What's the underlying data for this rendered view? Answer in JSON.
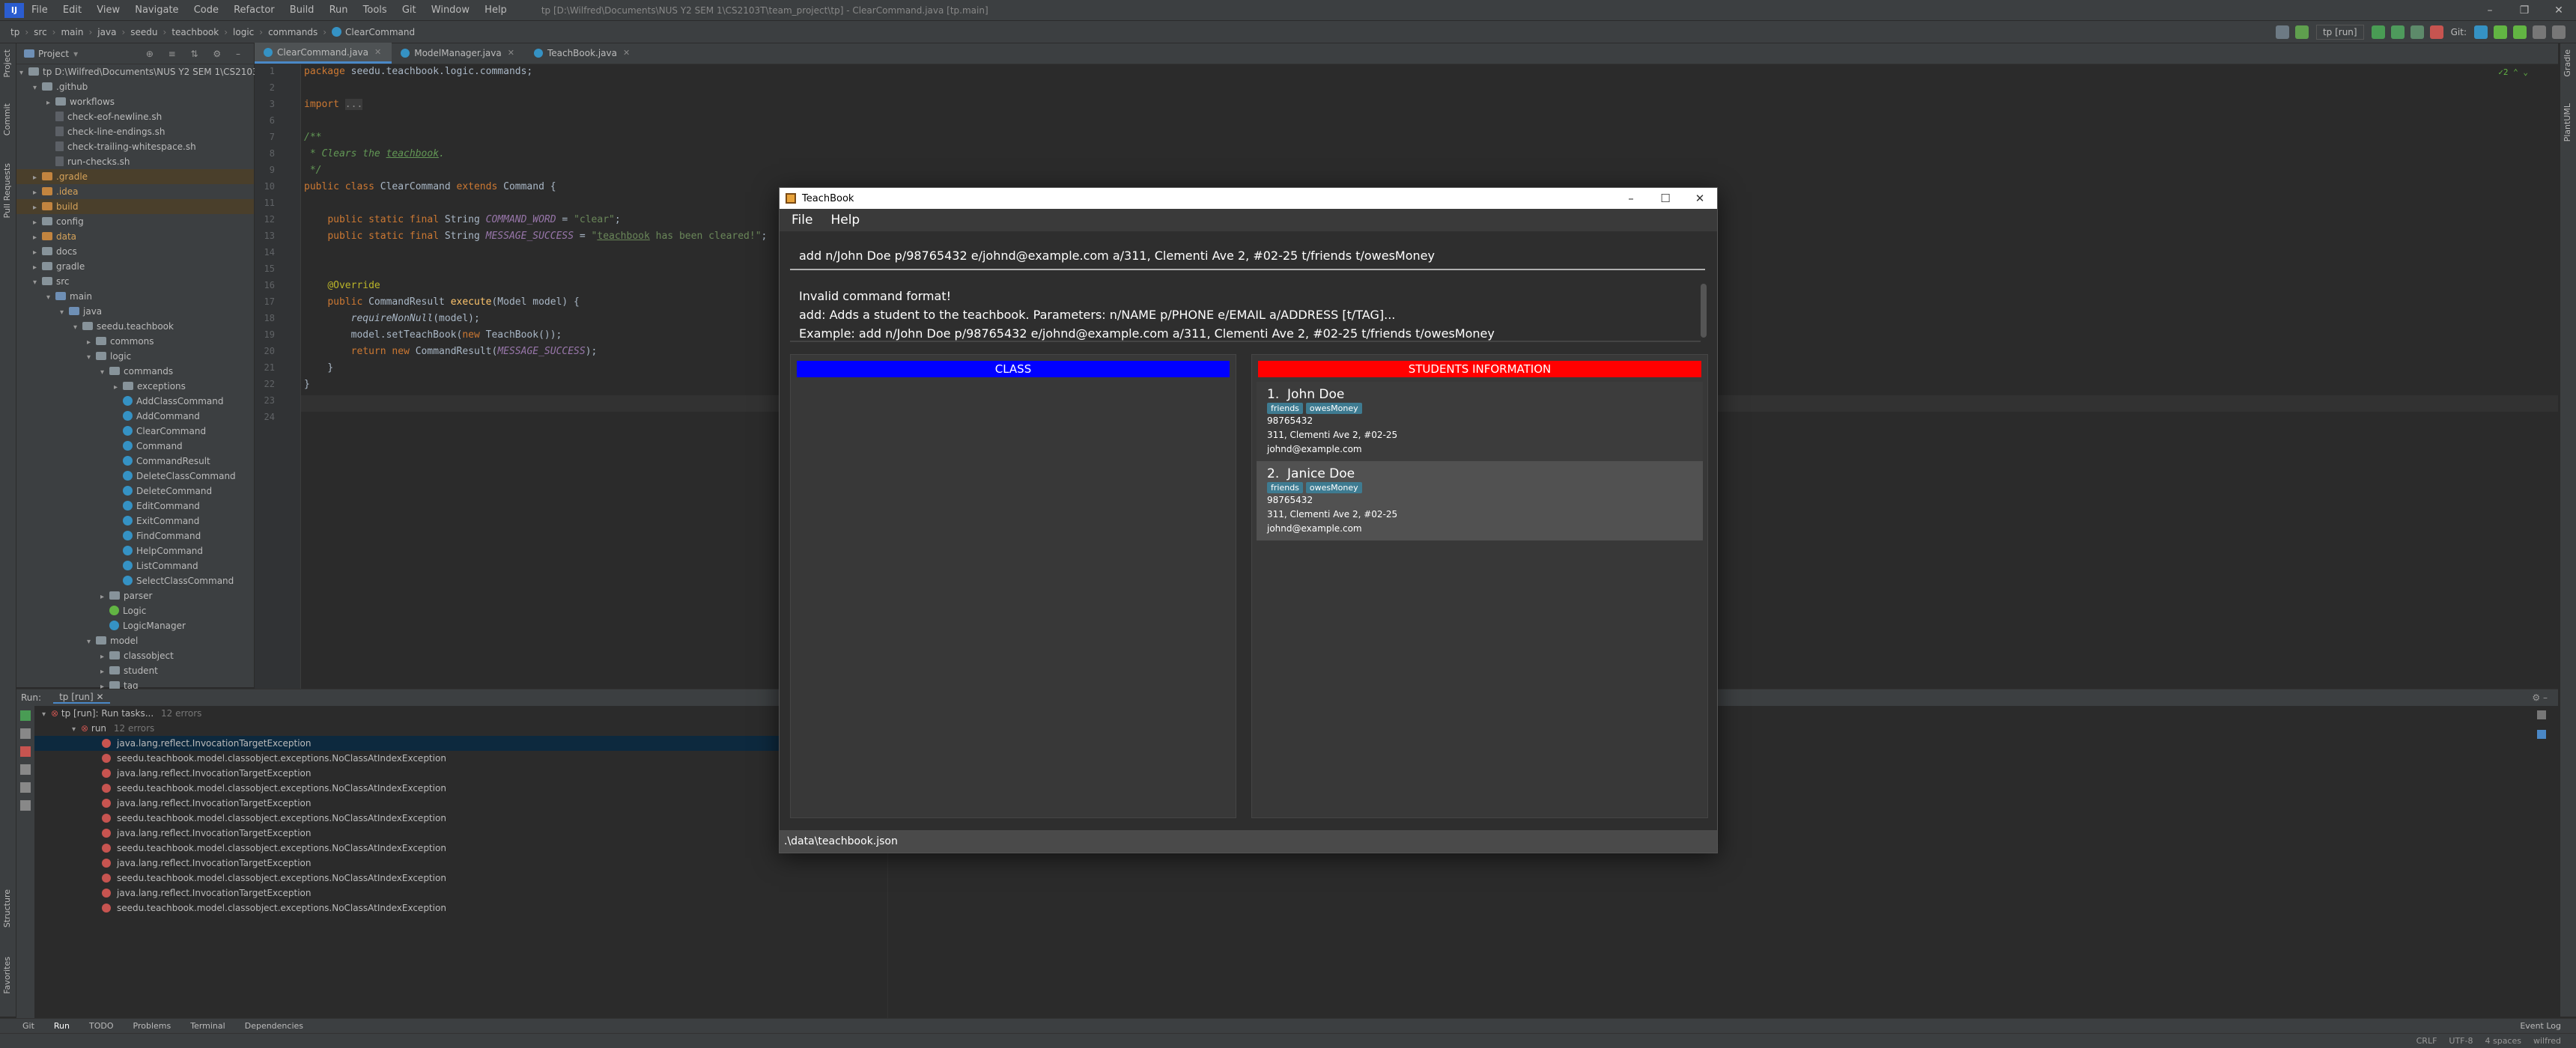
{
  "titlebar": {
    "menu": [
      "File",
      "Edit",
      "View",
      "Navigate",
      "Code",
      "Refactor",
      "Build",
      "Run",
      "Tools",
      "Git",
      "Window",
      "Help"
    ],
    "path": "tp [D:\\Wilfred\\Documents\\NUS Y2 SEM 1\\CS2103T\\team_project\\tp] - ClearCommand.java [tp.main]",
    "run_config": "tp [run]",
    "git_label": "Git:"
  },
  "breadcrumb": [
    "tp",
    "src",
    "main",
    "java",
    "seedu",
    "teachbook",
    "logic",
    "commands",
    "ClearCommand"
  ],
  "project": {
    "header": "Project",
    "rows": [
      {
        "label": "tp D:\\Wilfred\\Documents\\NUS Y2 SEM 1\\CS2103T\\team_project\\tp",
        "depth": 0,
        "kind": "folder",
        "open": true
      },
      {
        "label": ".github",
        "depth": 1,
        "kind": "folder",
        "open": true
      },
      {
        "label": "workflows",
        "depth": 2,
        "kind": "folder",
        "open": false
      },
      {
        "label": "check-eof-newline.sh",
        "depth": 2,
        "kind": "file"
      },
      {
        "label": "check-line-endings.sh",
        "depth": 2,
        "kind": "file"
      },
      {
        "label": "check-trailing-whitespace.sh",
        "depth": 2,
        "kind": "file"
      },
      {
        "label": "run-checks.sh",
        "depth": 2,
        "kind": "file"
      },
      {
        "label": ".gradle",
        "depth": 1,
        "kind": "folder-orange",
        "open": false,
        "hl": true
      },
      {
        "label": ".idea",
        "depth": 1,
        "kind": "folder-orange",
        "open": false
      },
      {
        "label": "build",
        "depth": 1,
        "kind": "folder-orange",
        "open": false,
        "hl": true
      },
      {
        "label": "config",
        "depth": 1,
        "kind": "folder",
        "open": false
      },
      {
        "label": "data",
        "depth": 1,
        "kind": "folder-orange",
        "open": false
      },
      {
        "label": "docs",
        "depth": 1,
        "kind": "folder",
        "open": false
      },
      {
        "label": "gradle",
        "depth": 1,
        "kind": "folder",
        "open": false
      },
      {
        "label": "src",
        "depth": 1,
        "kind": "folder",
        "open": true
      },
      {
        "label": "main",
        "depth": 2,
        "kind": "folder-blue",
        "open": true
      },
      {
        "label": "java",
        "depth": 3,
        "kind": "folder-blue",
        "open": true
      },
      {
        "label": "seedu.teachbook",
        "depth": 4,
        "kind": "folder",
        "open": true
      },
      {
        "label": "commons",
        "depth": 5,
        "kind": "folder",
        "open": false
      },
      {
        "label": "logic",
        "depth": 5,
        "kind": "folder",
        "open": true
      },
      {
        "label": "commands",
        "depth": 6,
        "kind": "folder",
        "open": true
      },
      {
        "label": "exceptions",
        "depth": 7,
        "kind": "folder",
        "open": false
      },
      {
        "label": "AddClassCommand",
        "depth": 7,
        "kind": "class"
      },
      {
        "label": "AddCommand",
        "depth": 7,
        "kind": "class"
      },
      {
        "label": "ClearCommand",
        "depth": 7,
        "kind": "class"
      },
      {
        "label": "Command",
        "depth": 7,
        "kind": "class"
      },
      {
        "label": "CommandResult",
        "depth": 7,
        "kind": "class"
      },
      {
        "label": "DeleteClassCommand",
        "depth": 7,
        "kind": "class"
      },
      {
        "label": "DeleteCommand",
        "depth": 7,
        "kind": "class"
      },
      {
        "label": "EditCommand",
        "depth": 7,
        "kind": "class"
      },
      {
        "label": "ExitCommand",
        "depth": 7,
        "kind": "class"
      },
      {
        "label": "FindCommand",
        "depth": 7,
        "kind": "class"
      },
      {
        "label": "HelpCommand",
        "depth": 7,
        "kind": "class"
      },
      {
        "label": "ListCommand",
        "depth": 7,
        "kind": "class"
      },
      {
        "label": "SelectClassCommand",
        "depth": 7,
        "kind": "class"
      },
      {
        "label": "parser",
        "depth": 6,
        "kind": "folder",
        "open": false
      },
      {
        "label": "Logic",
        "depth": 6,
        "kind": "interface"
      },
      {
        "label": "LogicManager",
        "depth": 6,
        "kind": "class"
      },
      {
        "label": "model",
        "depth": 5,
        "kind": "folder",
        "open": true
      },
      {
        "label": "classobject",
        "depth": 6,
        "kind": "folder",
        "open": false
      },
      {
        "label": "student",
        "depth": 6,
        "kind": "folder",
        "open": false
      },
      {
        "label": "tag",
        "depth": 6,
        "kind": "folder",
        "open": false
      }
    ]
  },
  "editor": {
    "tabs": [
      {
        "label": "ClearCommand.java",
        "active": true
      },
      {
        "label": "ModelManager.java",
        "active": false
      },
      {
        "label": "TeachBook.java",
        "active": false
      }
    ],
    "inspection": "2",
    "line_numbers": [
      "1",
      "2",
      "3",
      "6",
      "7",
      "8",
      "9",
      "10",
      "11",
      "12",
      "13",
      "14",
      "15",
      "16",
      "17",
      "18",
      "19",
      "20",
      "21",
      "22",
      "23",
      "24"
    ]
  },
  "run": {
    "label": "Run:",
    "tab": "tp [run]",
    "root": "tp [run]: Run tasks...",
    "root_meta": "12 errors",
    "child": "run",
    "child_meta": "12 errors",
    "errors": [
      "java.lang.reflect.InvocationTargetException",
      "seedu.teachbook.model.classobject.exceptions.NoClassAtIndexException",
      "java.lang.reflect.InvocationTargetException",
      "seedu.teachbook.model.classobject.exceptions.NoClassAtIndexException",
      "java.lang.reflect.InvocationTargetException",
      "seedu.teachbook.model.classobject.exceptions.NoClassAtIndexException",
      "java.lang.reflect.InvocationTargetException",
      "seedu.teachbook.model.classobject.exceptions.NoClassAtIndexException",
      "java.lang.reflect.InvocationTargetException",
      "seedu.teachbook.model.classobject.exceptions.NoClassAtIndexException",
      "java.lang.reflect.InvocationTargetException",
      "seedu.teachbook.model.classobject.exceptions.NoClassAtIndexException"
    ]
  },
  "bottom_tabs": [
    "Git",
    "Run",
    "TODO",
    "Problems",
    "Terminal",
    "Dependencies"
  ],
  "status": [
    "CRLF",
    "UTF-8",
    "4 spaces",
    "wilfred"
  ],
  "event_log": "Event Log",
  "teachbook": {
    "title": "TeachBook",
    "menu": [
      "File",
      "Help"
    ],
    "command": "add n/John Doe p/98765432 e/johnd@example.com a/311, Clementi Ave 2, #02-25 t/friends t/owesMoney",
    "result": [
      "Invalid command format!",
      "add: Adds a student to the teachbook. Parameters: n/NAME p/PHONE e/EMAIL a/ADDRESS [t/TAG]...",
      "Example: add n/John Doe p/98765432 e/johnd@example.com a/311, Clementi Ave 2, #02-25 t/friends t/owesMoney"
    ],
    "class_header": "CLASS",
    "class_header_color": "#0000ff",
    "students_header": "STUDENTS INFORMATION",
    "students_header_color": "#ff0000",
    "students": [
      {
        "index": "1.",
        "name": "John Doe",
        "tags": [
          "friends",
          "owesMoney"
        ],
        "phone": "98765432",
        "address": "311, Clementi Ave 2, #02-25",
        "email": "johnd@example.com"
      },
      {
        "index": "2.",
        "name": "Janice Doe",
        "tags": [
          "friends",
          "owesMoney"
        ],
        "phone": "98765432",
        "address": "311, Clementi Ave 2, #02-25",
        "email": "johnd@example.com"
      }
    ],
    "status": ".\\data\\teachbook.json"
  }
}
